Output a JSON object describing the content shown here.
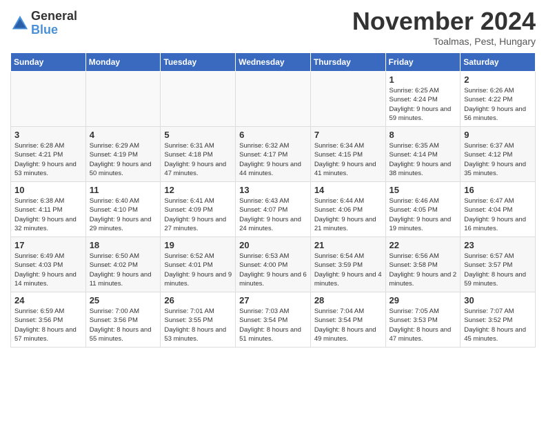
{
  "logo": {
    "general": "General",
    "blue": "Blue"
  },
  "header": {
    "month": "November 2024",
    "location": "Toalmas, Pest, Hungary"
  },
  "days_of_week": [
    "Sunday",
    "Monday",
    "Tuesday",
    "Wednesday",
    "Thursday",
    "Friday",
    "Saturday"
  ],
  "weeks": [
    [
      {
        "day": "",
        "info": ""
      },
      {
        "day": "",
        "info": ""
      },
      {
        "day": "",
        "info": ""
      },
      {
        "day": "",
        "info": ""
      },
      {
        "day": "",
        "info": ""
      },
      {
        "day": "1",
        "info": "Sunrise: 6:25 AM\nSunset: 4:24 PM\nDaylight: 9 hours and 59 minutes."
      },
      {
        "day": "2",
        "info": "Sunrise: 6:26 AM\nSunset: 4:22 PM\nDaylight: 9 hours and 56 minutes."
      }
    ],
    [
      {
        "day": "3",
        "info": "Sunrise: 6:28 AM\nSunset: 4:21 PM\nDaylight: 9 hours and 53 minutes."
      },
      {
        "day": "4",
        "info": "Sunrise: 6:29 AM\nSunset: 4:19 PM\nDaylight: 9 hours and 50 minutes."
      },
      {
        "day": "5",
        "info": "Sunrise: 6:31 AM\nSunset: 4:18 PM\nDaylight: 9 hours and 47 minutes."
      },
      {
        "day": "6",
        "info": "Sunrise: 6:32 AM\nSunset: 4:17 PM\nDaylight: 9 hours and 44 minutes."
      },
      {
        "day": "7",
        "info": "Sunrise: 6:34 AM\nSunset: 4:15 PM\nDaylight: 9 hours and 41 minutes."
      },
      {
        "day": "8",
        "info": "Sunrise: 6:35 AM\nSunset: 4:14 PM\nDaylight: 9 hours and 38 minutes."
      },
      {
        "day": "9",
        "info": "Sunrise: 6:37 AM\nSunset: 4:12 PM\nDaylight: 9 hours and 35 minutes."
      }
    ],
    [
      {
        "day": "10",
        "info": "Sunrise: 6:38 AM\nSunset: 4:11 PM\nDaylight: 9 hours and 32 minutes."
      },
      {
        "day": "11",
        "info": "Sunrise: 6:40 AM\nSunset: 4:10 PM\nDaylight: 9 hours and 29 minutes."
      },
      {
        "day": "12",
        "info": "Sunrise: 6:41 AM\nSunset: 4:09 PM\nDaylight: 9 hours and 27 minutes."
      },
      {
        "day": "13",
        "info": "Sunrise: 6:43 AM\nSunset: 4:07 PM\nDaylight: 9 hours and 24 minutes."
      },
      {
        "day": "14",
        "info": "Sunrise: 6:44 AM\nSunset: 4:06 PM\nDaylight: 9 hours and 21 minutes."
      },
      {
        "day": "15",
        "info": "Sunrise: 6:46 AM\nSunset: 4:05 PM\nDaylight: 9 hours and 19 minutes."
      },
      {
        "day": "16",
        "info": "Sunrise: 6:47 AM\nSunset: 4:04 PM\nDaylight: 9 hours and 16 minutes."
      }
    ],
    [
      {
        "day": "17",
        "info": "Sunrise: 6:49 AM\nSunset: 4:03 PM\nDaylight: 9 hours and 14 minutes."
      },
      {
        "day": "18",
        "info": "Sunrise: 6:50 AM\nSunset: 4:02 PM\nDaylight: 9 hours and 11 minutes."
      },
      {
        "day": "19",
        "info": "Sunrise: 6:52 AM\nSunset: 4:01 PM\nDaylight: 9 hours and 9 minutes."
      },
      {
        "day": "20",
        "info": "Sunrise: 6:53 AM\nSunset: 4:00 PM\nDaylight: 9 hours and 6 minutes."
      },
      {
        "day": "21",
        "info": "Sunrise: 6:54 AM\nSunset: 3:59 PM\nDaylight: 9 hours and 4 minutes."
      },
      {
        "day": "22",
        "info": "Sunrise: 6:56 AM\nSunset: 3:58 PM\nDaylight: 9 hours and 2 minutes."
      },
      {
        "day": "23",
        "info": "Sunrise: 6:57 AM\nSunset: 3:57 PM\nDaylight: 8 hours and 59 minutes."
      }
    ],
    [
      {
        "day": "24",
        "info": "Sunrise: 6:59 AM\nSunset: 3:56 PM\nDaylight: 8 hours and 57 minutes."
      },
      {
        "day": "25",
        "info": "Sunrise: 7:00 AM\nSunset: 3:56 PM\nDaylight: 8 hours and 55 minutes."
      },
      {
        "day": "26",
        "info": "Sunrise: 7:01 AM\nSunset: 3:55 PM\nDaylight: 8 hours and 53 minutes."
      },
      {
        "day": "27",
        "info": "Sunrise: 7:03 AM\nSunset: 3:54 PM\nDaylight: 8 hours and 51 minutes."
      },
      {
        "day": "28",
        "info": "Sunrise: 7:04 AM\nSunset: 3:54 PM\nDaylight: 8 hours and 49 minutes."
      },
      {
        "day": "29",
        "info": "Sunrise: 7:05 AM\nSunset: 3:53 PM\nDaylight: 8 hours and 47 minutes."
      },
      {
        "day": "30",
        "info": "Sunrise: 7:07 AM\nSunset: 3:52 PM\nDaylight: 8 hours and 45 minutes."
      }
    ]
  ]
}
